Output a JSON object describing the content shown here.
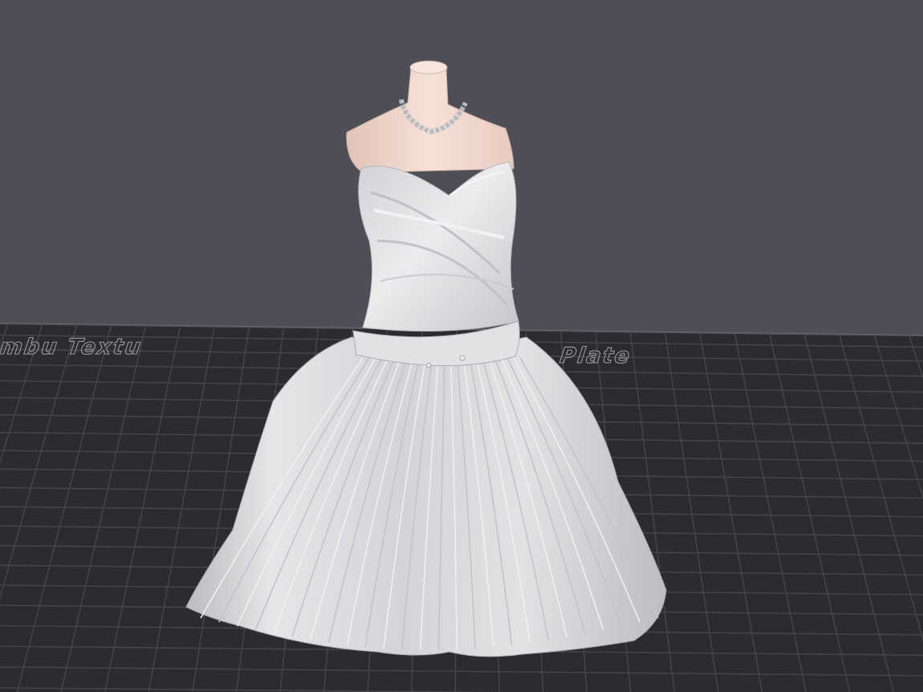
{
  "viewport": {
    "background_color": "#4e4e56",
    "plate_color": "#2c2c30",
    "grid_color": "#46464c",
    "model_color": "#e4e4e6",
    "skin_color": "#f1d9d0"
  },
  "build_plate": {
    "label_visible_left": "Bambu Textu",
    "label_visible_right": "Plate"
  },
  "model": {
    "name": "dress-on-mannequin-model"
  }
}
